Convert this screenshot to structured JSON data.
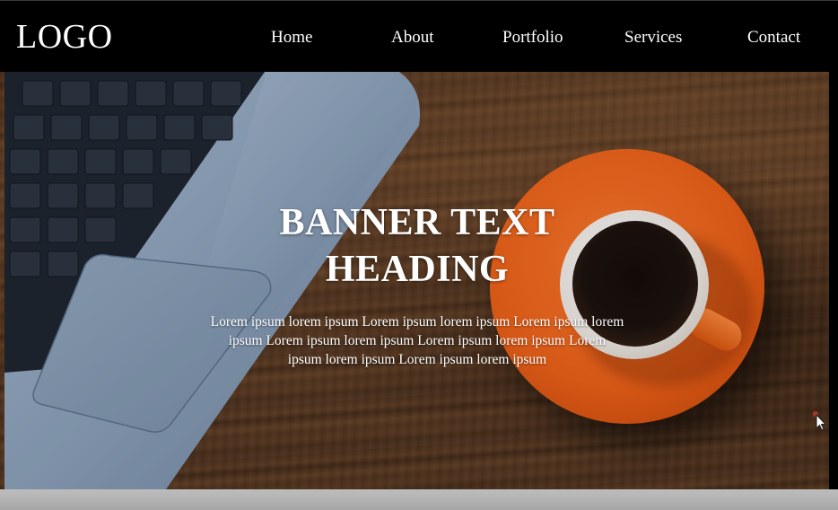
{
  "header": {
    "logo": "LOGO",
    "nav": [
      {
        "label": "Home"
      },
      {
        "label": "About"
      },
      {
        "label": "Portfolio"
      },
      {
        "label": "Services"
      },
      {
        "label": "Contact"
      }
    ]
  },
  "hero": {
    "heading_line1": "BANNER TEXT",
    "heading_line2": "HEADING",
    "paragraph": "Lorem ipsum lorem ipsum Lorem ipsum lorem ipsum Lorem ipsum lorem ipsum Lorem ipsum lorem ipsum Lorem ipsum lorem ipsum Lorem ipsum lorem ipsum Lorem ipsum lorem ipsum"
  },
  "colors": {
    "navbar_bg": "#000000",
    "text": "#ffffff",
    "saucer": "#f26419",
    "wood": "#5c3c23",
    "bottom_strip": "#b3b3b3"
  },
  "icons": {
    "cursor": "mouse-pointer-icon"
  }
}
